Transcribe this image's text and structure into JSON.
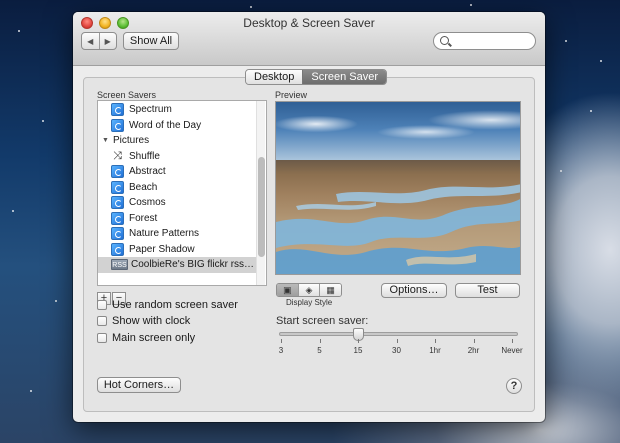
{
  "window": {
    "title": "Desktop & Screen Saver",
    "back_icon": "chevron-left-icon",
    "forward_icon": "chevron-right-icon",
    "show_all_label": "Show All",
    "search": {
      "value": "",
      "placeholder": ""
    }
  },
  "tabs": [
    {
      "label": "Desktop",
      "active": false
    },
    {
      "label": "Screen Saver",
      "active": true
    }
  ],
  "screen_savers": {
    "heading": "Screen Savers",
    "items": [
      {
        "label": "Spectrum",
        "icon": "screensaver-icon",
        "kind": "saver",
        "selected": false
      },
      {
        "label": "Word of the Day",
        "icon": "screensaver-icon",
        "kind": "saver",
        "selected": false
      },
      {
        "label": "Pictures",
        "icon": "disclosure-triangle-icon",
        "kind": "group",
        "selected": false
      },
      {
        "label": "Shuffle",
        "icon": "shuffle-icon",
        "kind": "shuffle",
        "selected": false
      },
      {
        "label": "Abstract",
        "icon": "screensaver-icon",
        "kind": "saver",
        "selected": false
      },
      {
        "label": "Beach",
        "icon": "screensaver-icon",
        "kind": "saver",
        "selected": false
      },
      {
        "label": "Cosmos",
        "icon": "screensaver-icon",
        "kind": "saver",
        "selected": false
      },
      {
        "label": "Forest",
        "icon": "screensaver-icon",
        "kind": "saver",
        "selected": false
      },
      {
        "label": "Nature Patterns",
        "icon": "screensaver-icon",
        "kind": "saver",
        "selected": false
      },
      {
        "label": "Paper Shadow",
        "icon": "screensaver-icon",
        "kind": "saver",
        "selected": false
      },
      {
        "label": "CoolbieRe's BIG flickr rss…",
        "icon": "rss-icon",
        "kind": "rss",
        "selected": true
      }
    ],
    "rss_badge": "RSS",
    "add_label": "+",
    "remove_label": "−"
  },
  "options": {
    "random": {
      "label": "Use random screen saver",
      "checked": false
    },
    "clock": {
      "label": "Show with clock",
      "checked": false
    },
    "main_only": {
      "label": "Main screen only",
      "checked": false
    }
  },
  "preview": {
    "heading": "Preview",
    "display_style_label": "Display Style",
    "display_style_buttons": [
      "slideshow-icon",
      "collage-icon",
      "mosaic-icon"
    ],
    "options_label": "Options…",
    "test_label": "Test"
  },
  "start": {
    "label": "Start screen saver:",
    "ticks": [
      "3",
      "5",
      "15",
      "30",
      "1hr",
      "2hr",
      "Never"
    ],
    "selected_index": 2
  },
  "hot_corners_label": "Hot Corners…",
  "help_label": "?"
}
